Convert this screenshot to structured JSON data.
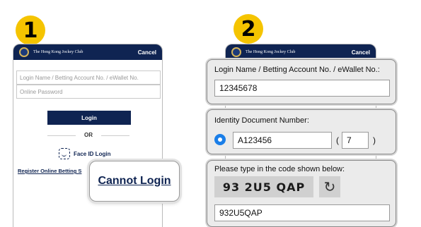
{
  "steps": {
    "one": "1",
    "two": "2"
  },
  "header": {
    "org": "The Hong Kong Jockey Club",
    "cancel": "Cancel"
  },
  "login_form": {
    "login_name_placeholder": "Login Name / Betting Account No. / eWallet No.",
    "password_placeholder": "Online Password",
    "login_button": "Login",
    "or_text": "OR",
    "face_id": "Face ID Login",
    "register": "Register Online Betting S"
  },
  "callout": {
    "cannot_login": "Cannot Login"
  },
  "recovery_form": {
    "login_name_label": "Login Name / Betting Account No. / eWallet No.:",
    "login_name_value": "12345678",
    "id_label": "Identity Document Number:",
    "id_value": "A123456",
    "check_digit_open": "(",
    "check_digit": "7",
    "check_digit_close": ")",
    "captcha_label": "Please type in the code shown below:",
    "captcha_image_text": "93 2U5 QAP",
    "captcha_value": "932U5QAP"
  },
  "colors": {
    "accent_yellow": "#f5c400",
    "navy": "#0f2452",
    "radio_blue": "#1a7ee8"
  }
}
